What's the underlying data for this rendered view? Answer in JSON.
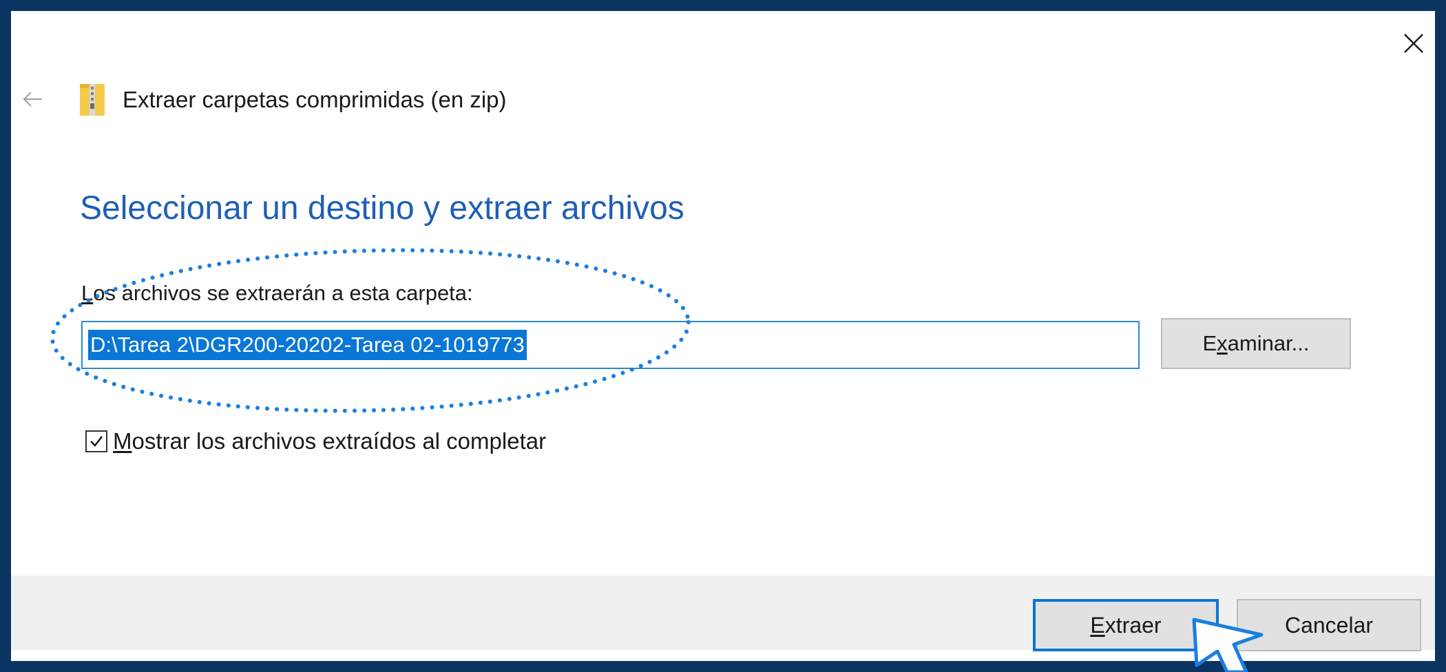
{
  "dialog": {
    "wizard_title": "Extraer carpetas comprimidas (en zip)",
    "heading": "Seleccionar un destino y extraer archivos",
    "folder_label_access": "L",
    "folder_label_rest": "os archivos se extraerán a esta carpeta:",
    "destination_path": "D:\\Tarea 2\\DGR200-20202-Tarea 02-1019773",
    "browse_button_pre": "E",
    "browse_button_access": "x",
    "browse_button_post": "aminar...",
    "show_files_checked": true,
    "show_files_access": "M",
    "show_files_rest": "ostrar los archivos extraídos al completar",
    "extract_button_access": "E",
    "extract_button_rest": "xtraer",
    "cancel_button": "Cancelar"
  },
  "icons": {
    "close": "close-icon",
    "back": "back-arrow-icon",
    "zip_folder": "zip-folder-icon",
    "checkbox": "checkmark-icon",
    "cursor": "pointer-cursor-icon"
  },
  "colors": {
    "frame_background": "#0b3463",
    "heading_blue": "#1e5fb5",
    "selection_blue": "#0a76d6",
    "annotation_dots": "#1a7fe0"
  }
}
